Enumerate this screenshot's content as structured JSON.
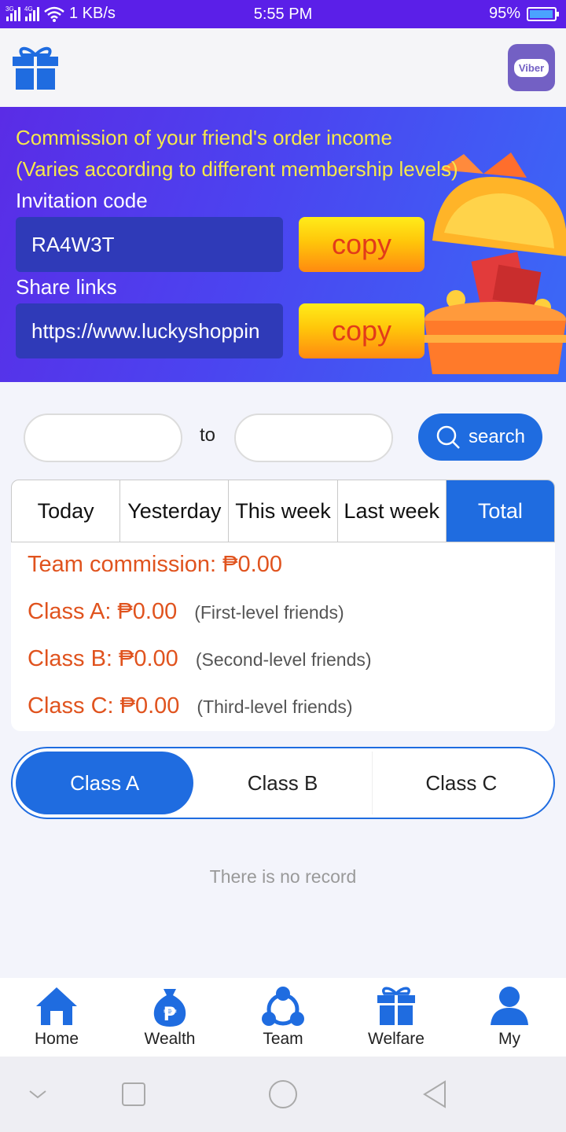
{
  "status_bar": {
    "network_left": "3G",
    "network_right": "4G",
    "speed": "1 KB/s",
    "time": "5:55 PM",
    "battery": "95%",
    "battery_level": 0.95
  },
  "header": {
    "left_icon": "gift-icon",
    "right_app": "Viber"
  },
  "banner": {
    "line1": "Commission of your friend's order income",
    "line2": "(Varies according to different membership levels)",
    "invite_label": "Invitation code",
    "invite_code": "RA4W3T",
    "share_label": "Share links",
    "share_link": "https://www.luckyshoppin",
    "copy_label": "copy"
  },
  "date_filter": {
    "from_value": "",
    "to_label": "to",
    "to_value": "",
    "search_label": "search"
  },
  "period_tabs": [
    {
      "label": "Today",
      "active": false
    },
    {
      "label": "Yesterday",
      "active": false
    },
    {
      "label": "This week",
      "active": false
    },
    {
      "label": "Last week",
      "active": false
    },
    {
      "label": "Total",
      "active": true
    }
  ],
  "commission": {
    "team": "Team commission: ₱0.00",
    "class_a": {
      "amount": "Class A: ₱0.00",
      "desc": "(First-level friends)"
    },
    "class_b": {
      "amount": "Class B: ₱0.00",
      "desc": "(Second-level friends)"
    },
    "class_c": {
      "amount": "Class C: ₱0.00",
      "desc": "(Third-level friends)"
    }
  },
  "class_tabs": [
    {
      "label": "Class A",
      "active": true
    },
    {
      "label": "Class B",
      "active": false
    },
    {
      "label": "Class C",
      "active": false
    }
  ],
  "empty_message": "There is no record",
  "bottom_nav": [
    {
      "label": "Home",
      "icon": "home-icon"
    },
    {
      "label": "Wealth",
      "icon": "money-bag-icon"
    },
    {
      "label": "Team",
      "icon": "team-icon"
    },
    {
      "label": "Welfare",
      "icon": "gift-icon"
    },
    {
      "label": "My",
      "icon": "user-icon"
    }
  ],
  "colors": {
    "primary": "#1f6ce0",
    "banner_text": "#f6e84a",
    "commission_text": "#e0531e",
    "status_bar": "#5b1fe8"
  }
}
